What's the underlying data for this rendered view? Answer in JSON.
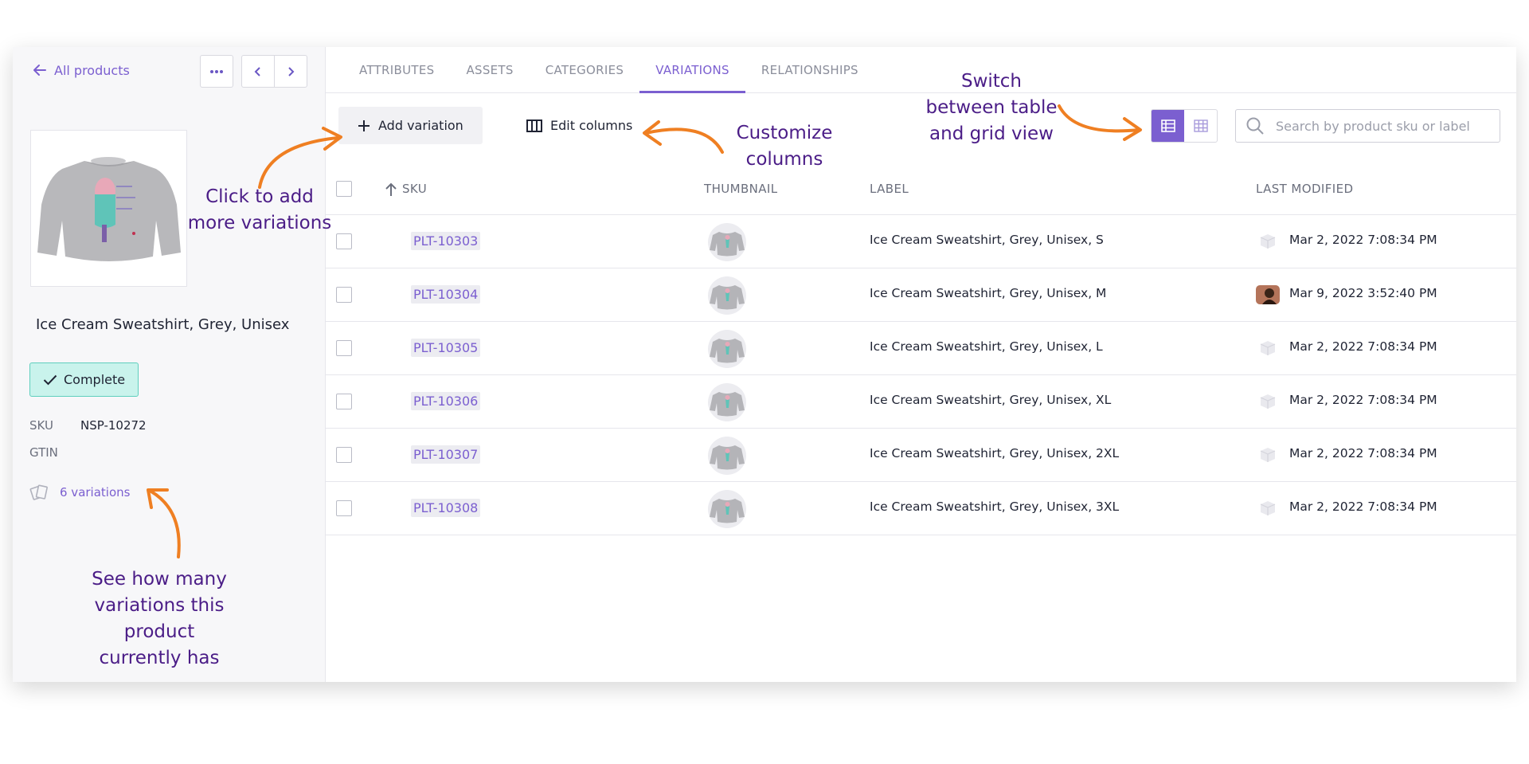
{
  "sidebar": {
    "back_label": "All products",
    "product_name": "Ice Cream Sweatshirt, Grey, Unisex",
    "status": "Complete",
    "meta": [
      {
        "key": "SKU",
        "value": "NSP-10272"
      },
      {
        "key": "GTIN",
        "value": ""
      }
    ],
    "variations_link": "6 variations"
  },
  "tabs": [
    {
      "label": "ATTRIBUTES",
      "active": false
    },
    {
      "label": "ASSETS",
      "active": false
    },
    {
      "label": "CATEGORIES",
      "active": false
    },
    {
      "label": "VARIATIONS",
      "active": true
    },
    {
      "label": "RELATIONSHIPS",
      "active": false
    }
  ],
  "toolbar": {
    "add_label": "Add variation",
    "edit_label": "Edit columns",
    "search_placeholder": "Search by product sku or label"
  },
  "table": {
    "headers": {
      "sku": "SKU",
      "thumbnail": "THUMBNAIL",
      "label": "LABEL",
      "modified": "LAST MODIFIED"
    },
    "rows": [
      {
        "sku": "PLT-10303",
        "label": "Ice Cream Sweatshirt, Grey, Unisex, S",
        "modified": "Mar 2, 2022 7:08:34 PM",
        "avatar": "cube"
      },
      {
        "sku": "PLT-10304",
        "label": "Ice Cream Sweatshirt, Grey, Unisex, M",
        "modified": "Mar 9, 2022 3:52:40 PM",
        "avatar": "photo"
      },
      {
        "sku": "PLT-10305",
        "label": "Ice Cream Sweatshirt, Grey, Unisex, L",
        "modified": "Mar 2, 2022 7:08:34 PM",
        "avatar": "cube"
      },
      {
        "sku": "PLT-10306",
        "label": "Ice Cream Sweatshirt, Grey, Unisex, XL",
        "modified": "Mar 2, 2022 7:08:34 PM",
        "avatar": "cube"
      },
      {
        "sku": "PLT-10307",
        "label": "Ice Cream Sweatshirt, Grey, Unisex, 2XL",
        "modified": "Mar 2, 2022 7:08:34 PM",
        "avatar": "cube"
      },
      {
        "sku": "PLT-10308",
        "label": "Ice Cream Sweatshirt, Grey, Unisex, 3XL",
        "modified": "Mar 2, 2022 7:08:34 PM",
        "avatar": "cube"
      }
    ]
  },
  "annotations": {
    "add": [
      "Click to add",
      "more variations"
    ],
    "columns": [
      "Customize",
      "columns"
    ],
    "view": [
      "Switch",
      "between table",
      "and grid view"
    ],
    "count": [
      "See how many",
      "variations this",
      "product",
      "currently has"
    ]
  },
  "colors": {
    "accent": "#7b5fd0",
    "status_bg": "#c9f3ec",
    "annotation_text": "#4b1d87",
    "annotation_arrow": "#ef7f22"
  }
}
